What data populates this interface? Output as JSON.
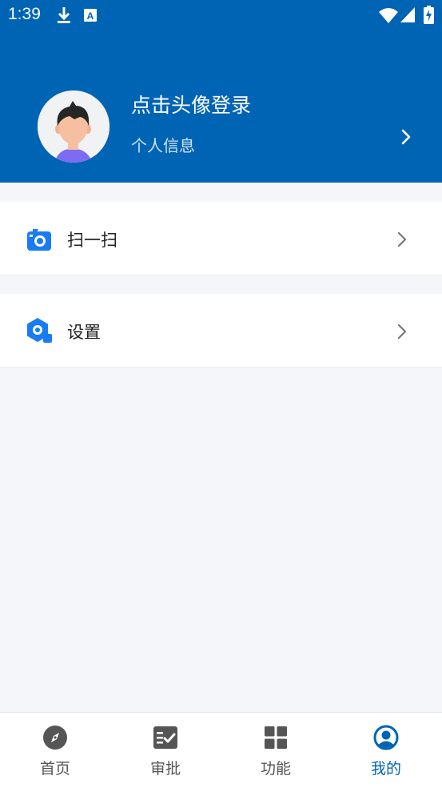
{
  "status_bar": {
    "time": "1:39",
    "icons": [
      "download-icon",
      "keyboard-a-icon",
      "wifi-icon",
      "signal-icon",
      "battery-charging-icon"
    ]
  },
  "profile": {
    "title": "点击头像登录",
    "subtitle": "个人信息",
    "avatar_icon": "user-avatar-icon"
  },
  "menu": [
    {
      "label": "扫一扫",
      "icon": "camera-scan-icon"
    },
    {
      "label": "设置",
      "icon": "settings-hex-icon"
    }
  ],
  "tabs": [
    {
      "label": "首页",
      "icon": "compass-icon",
      "active": false
    },
    {
      "label": "审批",
      "icon": "approval-check-icon",
      "active": false
    },
    {
      "label": "功能",
      "icon": "grid-icon",
      "active": false
    },
    {
      "label": "我的",
      "icon": "user-circle-icon",
      "active": true
    }
  ],
  "colors": {
    "brand": "#0064b4",
    "icon_blue": "#1a7cf2",
    "background": "#f4f6f9",
    "tab_inactive": "#555555"
  }
}
